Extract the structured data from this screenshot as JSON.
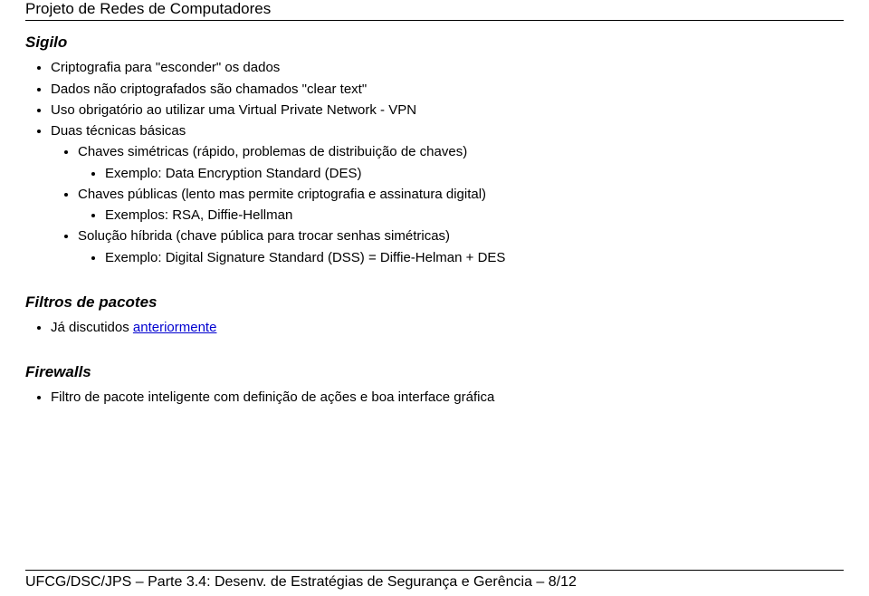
{
  "header": {
    "title": "Projeto de Redes de Computadores"
  },
  "sections": {
    "sigilo": {
      "heading": "Sigilo",
      "items": {
        "i0": "Criptografia para \"esconder\" os dados",
        "i1": "Dados não criptografados são chamados \"clear text\"",
        "i2": "Uso obrigatório ao utilizar uma Virtual Private Network - VPN",
        "i3": "Duas técnicas básicas",
        "i3_children": {
          "c0": "Chaves simétricas (rápido, problemas de distribuição de chaves)",
          "c0_children": {
            "d0": "Exemplo: Data Encryption Standard (DES)"
          },
          "c1": "Chaves públicas (lento mas permite criptografia e assinatura digital)",
          "c1_children": {
            "d0": "Exemplos: RSA, Diffie-Hellman"
          },
          "c2": "Solução híbrida (chave pública para trocar senhas simétricas)",
          "c2_children": {
            "d0": "Exemplo: Digital Signature Standard (DSS) = Diffie-Helman + DES"
          }
        }
      }
    },
    "filtros": {
      "heading": "Filtros de pacotes",
      "item_prefix": "Já discutidos ",
      "item_link": "anteriormente"
    },
    "firewalls": {
      "heading": "Firewalls",
      "items": {
        "i0": "Filtro de pacote inteligente com definição de ações e boa interface gráfica"
      }
    }
  },
  "footer": {
    "left": "UFCG/DSC/JPS – Parte 3.4: Desenv. de Estratégias de Segurança e Gerência – 8/12",
    "right": ""
  }
}
